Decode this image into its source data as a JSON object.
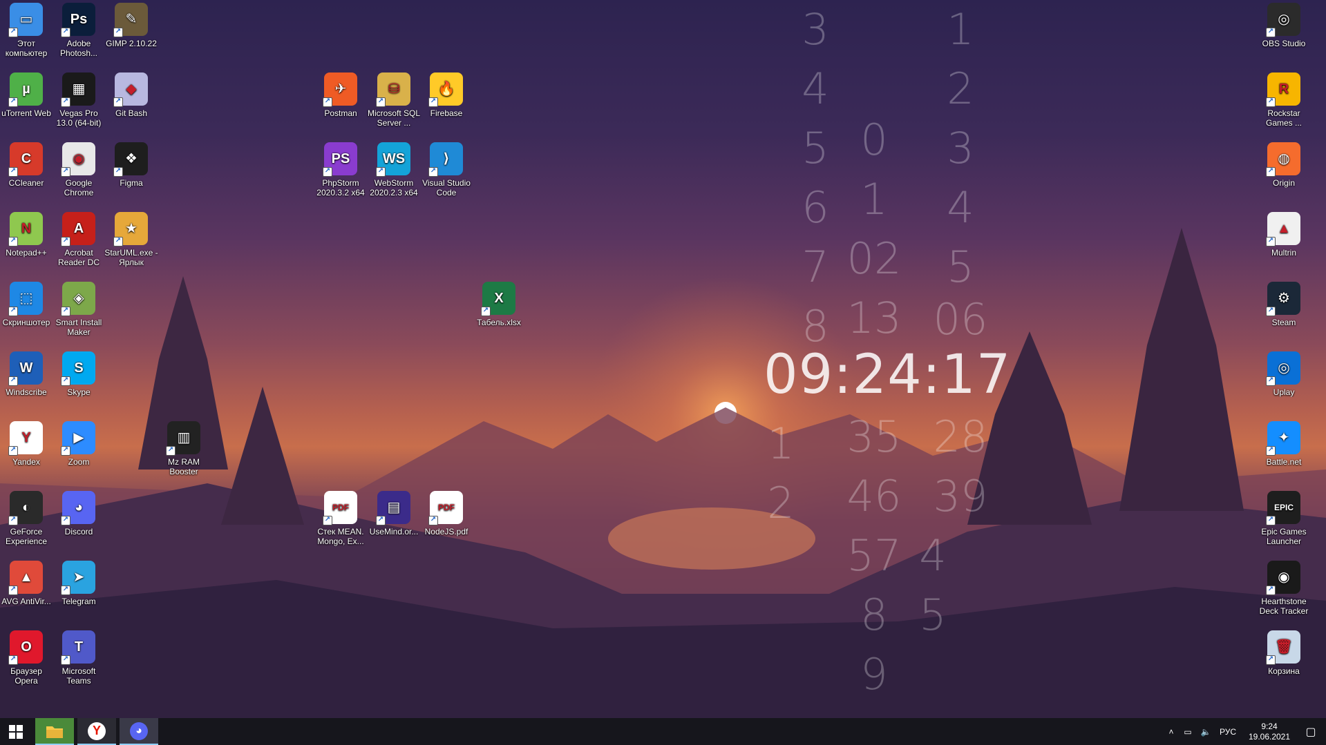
{
  "desktop": {
    "left_icons": [
      {
        "label": "Этот компьютер",
        "icon": "computer-icon",
        "color": "#3a8ee6",
        "glyph": "▭"
      },
      {
        "label": "Adobe Photosh...",
        "icon": "photoshop-icon",
        "color": "#0b1e3b",
        "glyph": "Ps"
      },
      {
        "label": "GIMP 2.10.22",
        "icon": "gimp-icon",
        "color": "#6b5a3a",
        "glyph": "✎"
      },
      {
        "label": "uTorrent Web",
        "icon": "utorrent-icon",
        "color": "#4fb048",
        "glyph": "µ"
      },
      {
        "label": "Vegas Pro 13.0 (64-bit)",
        "icon": "vegas-icon",
        "color": "#1a1a1a",
        "glyph": "▦"
      },
      {
        "label": "Git Bash",
        "icon": "git-bash-icon",
        "color": "#b8b8e0",
        "glyph": "◆"
      },
      {
        "label": "CCleaner",
        "icon": "ccleaner-icon",
        "color": "#d73a2a",
        "glyph": "C"
      },
      {
        "label": "Google Chrome",
        "icon": "chrome-icon",
        "color": "#e8e8e8",
        "glyph": "◉"
      },
      {
        "label": "Figma",
        "icon": "figma-icon",
        "color": "#1e1e1e",
        "glyph": "❖"
      },
      {
        "label": "Notepad++",
        "icon": "notepadpp-icon",
        "color": "#8fc84f",
        "glyph": "N"
      },
      {
        "label": "Acrobat Reader DC",
        "icon": "acrobat-icon",
        "color": "#c6201a",
        "glyph": "A"
      },
      {
        "label": "StarUML.exe - Ярлык",
        "icon": "staruml-icon",
        "color": "#e6a83a",
        "glyph": "★"
      },
      {
        "label": "Скриншотер",
        "icon": "screenshot-icon",
        "color": "#1e88e5",
        "glyph": "⬚"
      },
      {
        "label": "Smart Install Maker",
        "icon": "smart-install-icon",
        "color": "#7da84a",
        "glyph": "◈"
      },
      {
        "label": "Windscribe",
        "icon": "windscribe-icon",
        "color": "#1e5fb8",
        "glyph": "W"
      },
      {
        "label": "Skype",
        "icon": "skype-icon",
        "color": "#00a9f0",
        "glyph": "S"
      },
      {
        "label": "Yandex",
        "icon": "yandex-icon",
        "color": "#ffffff",
        "glyph": "Y"
      },
      {
        "label": "Zoom",
        "icon": "zoom-icon",
        "color": "#2d8cff",
        "glyph": "▶"
      },
      {
        "label": "GeForce Experience",
        "icon": "geforce-icon",
        "color": "#2a2a2a",
        "glyph": "◐"
      },
      {
        "label": "Discord",
        "icon": "discord-icon",
        "color": "#5865f2",
        "glyph": "◕"
      },
      {
        "label": "AVG AntiVir...",
        "icon": "avg-icon",
        "color": "#e04a3a",
        "glyph": "▲"
      },
      {
        "label": "Telegram",
        "icon": "telegram-icon",
        "color": "#2aa3e0",
        "glyph": "➤"
      },
      {
        "label": "Браузер Opera",
        "icon": "opera-icon",
        "color": "#e0182c",
        "glyph": "O"
      },
      {
        "label": "Microsoft Teams",
        "icon": "teams-icon",
        "color": "#5059c9",
        "glyph": "T"
      },
      {
        "label": "Mz RAM Booster",
        "icon": "ram-booster-icon",
        "color": "#222222",
        "glyph": "▥"
      }
    ],
    "middle_icons": [
      {
        "label": "Postman",
        "icon": "postman-icon",
        "color": "#ef5b25",
        "glyph": "✈"
      },
      {
        "label": "Microsoft SQL Server ...",
        "icon": "sql-server-icon",
        "color": "#d9b14a",
        "glyph": "⛁"
      },
      {
        "label": "Firebase",
        "icon": "firebase-icon",
        "color": "#ffca28",
        "glyph": "🔥"
      },
      {
        "label": "PhpStorm 2020.3.2 x64",
        "icon": "phpstorm-icon",
        "color": "#8a3ccf",
        "glyph": "PS"
      },
      {
        "label": "WebStorm 2020.2.3 x64",
        "icon": "webstorm-icon",
        "color": "#14a3d8",
        "glyph": "WS"
      },
      {
        "label": "Visual Studio Code",
        "icon": "vscode-icon",
        "color": "#1f8ad6",
        "glyph": "⟩"
      },
      {
        "label": "Табель.xlsx",
        "icon": "excel-file-icon",
        "color": "#1d7a45",
        "glyph": "X"
      },
      {
        "label": "Стек MEAN. Mongo, Ex...",
        "icon": "pdf-file-icon",
        "color": "#ffffff",
        "glyph": "PDF"
      },
      {
        "label": "UseMind.or...",
        "icon": "usemind-icon",
        "color": "#3b2b8a",
        "glyph": "▤"
      },
      {
        "label": "NodeJS.pdf",
        "icon": "pdf-file-icon",
        "color": "#ffffff",
        "glyph": "PDF"
      }
    ],
    "right_icons": [
      {
        "label": "OBS Studio",
        "icon": "obs-icon",
        "color": "#2b2b2b",
        "glyph": "◎"
      },
      {
        "label": "Rockstar Games ...",
        "icon": "rockstar-icon",
        "color": "#f7b500",
        "glyph": "R"
      },
      {
        "label": "Origin",
        "icon": "origin-icon",
        "color": "#f56c2d",
        "glyph": "◍"
      },
      {
        "label": "Multrin",
        "icon": "multrin-icon",
        "color": "#f0f0f0",
        "glyph": "▲"
      },
      {
        "label": "Steam",
        "icon": "steam-icon",
        "color": "#1b2838",
        "glyph": "⚙"
      },
      {
        "label": "Uplay",
        "icon": "uplay-icon",
        "color": "#0a70d6",
        "glyph": "◎"
      },
      {
        "label": "Battle.net",
        "icon": "battlenet-icon",
        "color": "#148eff",
        "glyph": "✦"
      },
      {
        "label": "Epic Games Launcher",
        "icon": "epic-games-icon",
        "color": "#1e1e1e",
        "glyph": "EPIC"
      },
      {
        "label": "Hearthstone Deck Tracker",
        "icon": "hearthstone-tracker-icon",
        "color": "#1a1a1a",
        "glyph": "◉"
      },
      {
        "label": "Корзина",
        "icon": "recycle-bin-icon",
        "color": "#c8d8e8",
        "glyph": "🗑"
      }
    ]
  },
  "clock_widget": {
    "time": "09:24:17",
    "col1": [
      "3",
      "4",
      "5",
      "6",
      "7",
      "8",
      "1",
      "2"
    ],
    "col2": [
      "0",
      "1",
      "02",
      "13",
      "35",
      "46",
      "57",
      "8",
      "9"
    ],
    "col3": [
      "1",
      "2",
      "3",
      "4",
      "5",
      "06",
      "28",
      "39",
      "4",
      "5"
    ]
  },
  "taskbar": {
    "apps": [
      {
        "name": "file-explorer",
        "icon": "folder-icon",
        "color": "#f6c94a"
      },
      {
        "name": "yandex-browser",
        "icon": "yandex-icon",
        "color": "#e61400"
      },
      {
        "name": "discord",
        "icon": "discord-icon",
        "color": "#5865f2"
      }
    ],
    "tray": {
      "chevron": "˄",
      "lang": "РУС",
      "time": "9:24",
      "date": "19.06.2021"
    }
  }
}
